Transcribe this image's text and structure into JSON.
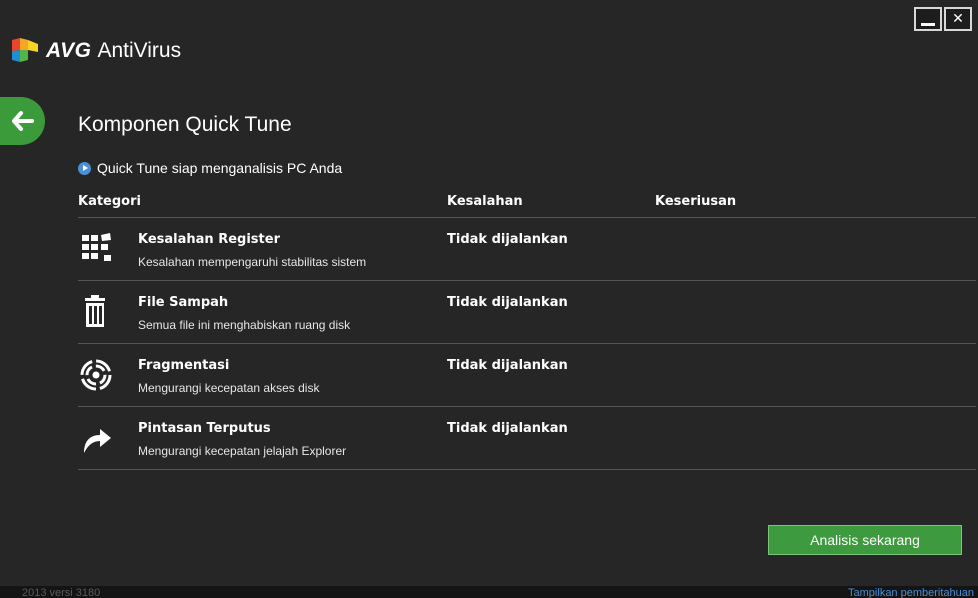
{
  "app": {
    "brand": "AVG",
    "product": "AntiVirus"
  },
  "page": {
    "title": "Komponen Quick Tune",
    "status": "Quick Tune siap menganalisis PC Anda"
  },
  "table": {
    "headers": [
      "Kategori",
      "Kesalahan",
      "Keseriusan"
    ],
    "rows": [
      {
        "icon": "registry-icon",
        "name": "Kesalahan Register",
        "desc": "Kesalahan mempengaruhi stabilitas sistem",
        "error": "Tidak dijalankan"
      },
      {
        "icon": "trash-icon",
        "name": "File Sampah",
        "desc": "Semua file ini menghabiskan ruang disk",
        "error": "Tidak dijalankan"
      },
      {
        "icon": "fragmentation-icon",
        "name": "Fragmentasi",
        "desc": "Mengurangi kecepatan akses disk",
        "error": "Tidak dijalankan"
      },
      {
        "icon": "broken-shortcut-icon",
        "name": "Pintasan Terputus",
        "desc": "Mengurangi kecepatan jelajah Explorer",
        "error": "Tidak dijalankan"
      }
    ]
  },
  "actions": {
    "analyze": "Analisis sekarang"
  },
  "footer": {
    "version": "2013  versi 3180",
    "notifications": "Tampilkan pemberitahuan"
  },
  "colors": {
    "accent_green": "#3e9a3e",
    "link_blue": "#4a8fd6",
    "background": "#262626"
  }
}
